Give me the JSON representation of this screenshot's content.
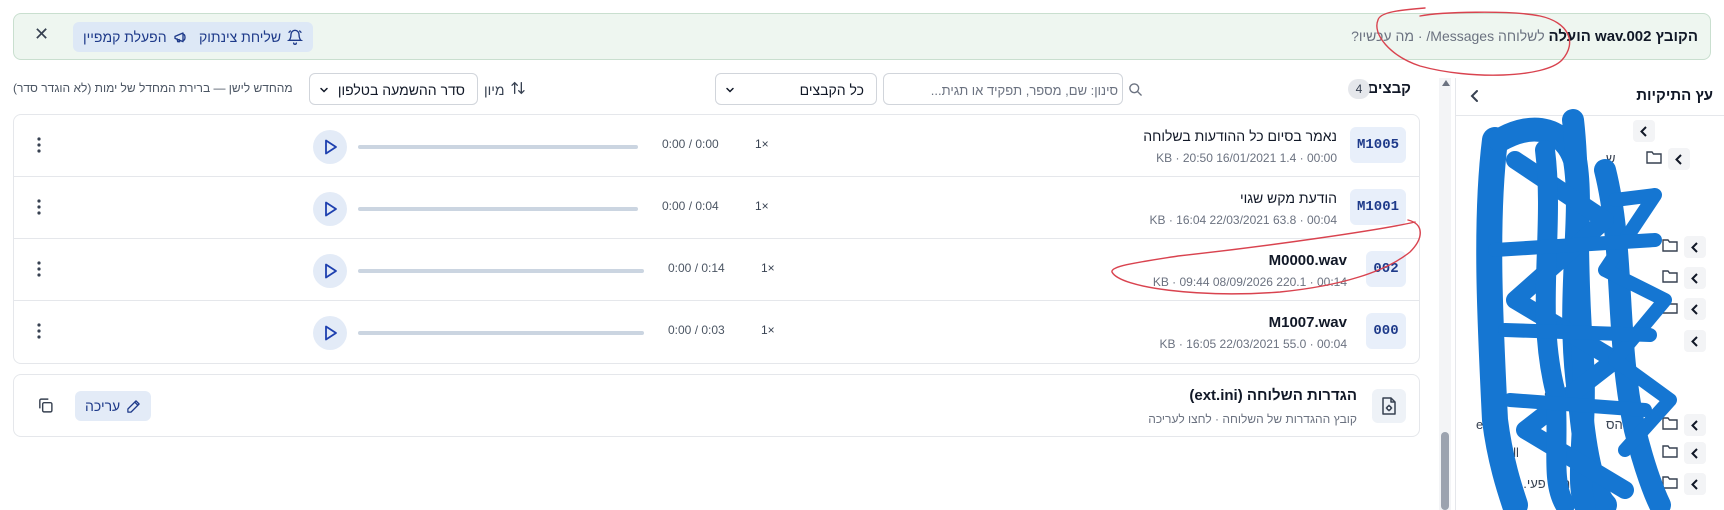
{
  "banner": {
    "message_strong": "הקובץ wav.002 הועלה",
    "message_rest": "לשלוחה Messages/ · מה עכשיו?",
    "push_button": "שליחת צינתוק",
    "campaign_button": "הפעלת קמפיין"
  },
  "toolbar": {
    "files_title": "קבצים",
    "files_count": "4",
    "search_placeholder": "סינון: שם, מספר, תפקיד או תגית...",
    "filter_select": "כל הקבצים",
    "sort_label": "מיון",
    "sort_select": "סדר ההשמעה בטלפון",
    "sort_note": "מהחדש לישן — ברירת המחדל של ימות (לא הוגדר סדר)"
  },
  "files": [
    {
      "code": "M1005",
      "name": "נאמר בסיום כל ההודעות בשלוחה",
      "duration": "00:00",
      "size": "1.4",
      "size_unit": "KB",
      "date": "20:50 16/01/2021",
      "time_readout": "0:00 / 0:00",
      "speed": "1×",
      "progress": 0,
      "bold": false
    },
    {
      "code": "M1001",
      "name": "הודעת מקש שגוי",
      "duration": "00:04",
      "size": "63.8",
      "size_unit": "KB",
      "date": "16:04 22/03/2021",
      "time_readout": "0:00 / 0:04",
      "speed": "1×",
      "progress": 0,
      "bold": false
    },
    {
      "code": "002",
      "name": "M0000.wav",
      "duration": "00:14",
      "size": "220.1",
      "size_unit": "KB",
      "date": "09:44 08/09/2026",
      "time_readout": "0:00 / 0:14",
      "speed": "1×",
      "progress": 0,
      "bold": true
    },
    {
      "code": "000",
      "name": "M1007.wav",
      "duration": "00:04",
      "size": "55.0",
      "size_unit": "KB",
      "date": "16:05 22/03/2021",
      "time_readout": "0:00 / 0:03",
      "speed": "1×",
      "progress": 0,
      "bold": true
    }
  ],
  "settings": {
    "title": "הגדרות השלוחה (ext.ini)",
    "subtitle": "קובץ ההגדרות של השלוחה · לחצו לעריכה",
    "edit_button": "עריכה"
  },
  "sidebar": {
    "title": "עץ התיקיות",
    "visible_fragments": [
      "ש",
      "8",
      "erID",
      "הס",
      "Lin",
      "sAll",
      "ת ודוחות פעי..."
    ]
  },
  "colors": {
    "accent": "#1e3a8a",
    "banner_bg": "#eef6f0",
    "chip_bg": "#e8effa",
    "annotation_red": "#d9434f",
    "scribble_blue": "#1576d2"
  }
}
